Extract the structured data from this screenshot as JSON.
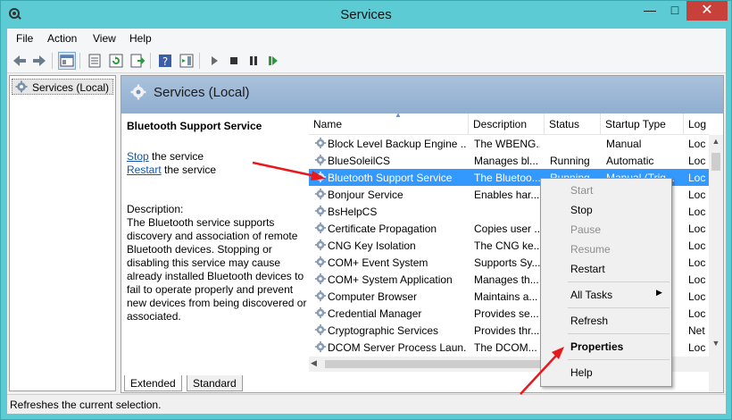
{
  "window": {
    "title": "Services",
    "controls": {
      "minimize": "—",
      "maximize": "□",
      "close": "✕"
    }
  },
  "menu": [
    "File",
    "Action",
    "View",
    "Help"
  ],
  "tree": {
    "label": "Services (Local)"
  },
  "header": {
    "label": "Services (Local)"
  },
  "description": {
    "service_name": "Bluetooth Support Service",
    "stop_link": "Stop",
    "stop_suffix": " the service",
    "restart_link": "Restart",
    "restart_suffix": " the service",
    "label": "Description:",
    "text": "The Bluetooth service supports discovery and association of remote Bluetooth devices.  Stopping or disabling this service may cause already installed Bluetooth devices to fail to operate properly and prevent new devices from being discovered or associated."
  },
  "columns": {
    "name": "Name",
    "description": "Description",
    "status": "Status",
    "startup": "Startup Type",
    "logon": "Log"
  },
  "rows": [
    {
      "name": "Block Level Backup Engine ...",
      "description": "The WBENG...",
      "status": "",
      "startup": "Manual",
      "logon": "Loc"
    },
    {
      "name": "BlueSoleilCS",
      "description": "Manages bl...",
      "status": "Running",
      "startup": "Automatic",
      "logon": "Loc"
    },
    {
      "name": "Bluetooth Support Service",
      "description": "The Bluetoo...",
      "status": "Running",
      "startup": "Manual (Trig...",
      "logon": "Loc"
    },
    {
      "name": "Bonjour Service",
      "description": "Enables har...",
      "status": "",
      "startup": "",
      "logon": "Loc"
    },
    {
      "name": "BsHelpCS",
      "description": "",
      "status": "",
      "startup": "",
      "logon": "Loc"
    },
    {
      "name": "Certificate Propagation",
      "description": "Copies user ...",
      "status": "",
      "startup": "",
      "logon": "Loc"
    },
    {
      "name": "CNG Key Isolation",
      "description": "The CNG ke...",
      "status": "",
      "startup": "",
      "logon": "Loc"
    },
    {
      "name": "COM+ Event System",
      "description": "Supports Sy...",
      "status": "",
      "startup": "",
      "logon": "Loc"
    },
    {
      "name": "COM+ System Application",
      "description": "Manages th...",
      "status": "",
      "startup": "",
      "logon": "Loc"
    },
    {
      "name": "Computer Browser",
      "description": "Maintains a...",
      "status": "",
      "startup": "",
      "logon": "Loc"
    },
    {
      "name": "Credential Manager",
      "description": "Provides se...",
      "status": "",
      "startup": "",
      "logon": "Loc"
    },
    {
      "name": "Cryptographic Services",
      "description": "Provides thr...",
      "status": "",
      "startup": "",
      "logon": "Net"
    },
    {
      "name": "DCOM Server Process Laun...",
      "description": "The DCOM...",
      "status": "",
      "startup": "",
      "logon": "Loc"
    }
  ],
  "tabs": {
    "extended": "Extended",
    "standard": "Standard"
  },
  "status": "Refreshes the current selection.",
  "context_menu": {
    "start": "Start",
    "stop": "Stop",
    "pause": "Pause",
    "resume": "Resume",
    "restart": "Restart",
    "all_tasks": "All Tasks",
    "refresh": "Refresh",
    "properties": "Properties",
    "help": "Help"
  },
  "colors": {
    "selection": "#3399ff",
    "arrow": "#e8191d",
    "header_band": "#a9c2dc",
    "window_frame": "#5ccbd3",
    "link": "#1457a8"
  }
}
